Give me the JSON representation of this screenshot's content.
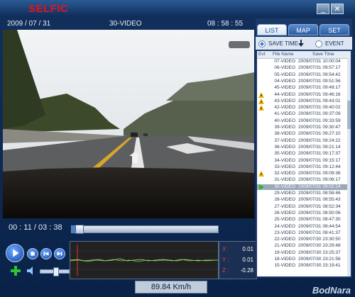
{
  "app": {
    "brand": "SELFIC"
  },
  "window_buttons": {
    "minimize": "_",
    "close": "✕"
  },
  "video_header": {
    "date": "2009 / 07 / 31",
    "title": "30-VIDEO",
    "time": "08 : 58 : 55"
  },
  "playback": {
    "time": "00 : 11 / 03 : 38",
    "progress": 0.05
  },
  "gsensor": {
    "x_label": "X :",
    "x_value": "0.01",
    "y_label": "Y :",
    "y_value": "0.01",
    "z_label": "Z :",
    "z_value": "-0.28"
  },
  "speed": "89.84 Km/h",
  "tabs": [
    "LIST",
    "MAP",
    "SET"
  ],
  "filter": {
    "save_time": "SAVE TIME",
    "event": "EVENT"
  },
  "list": {
    "headers": {
      "event": "Evt",
      "file_name": "File Name",
      "save_time": "Save Time"
    },
    "rows": [
      {
        "event": "",
        "name": "07-VIDEO",
        "time": "2009/07/31 10:00:04"
      },
      {
        "event": "",
        "name": "06-VIDEO",
        "time": "2009/07/31 09:57:17"
      },
      {
        "event": "",
        "name": "05-VIDEO",
        "time": "2009/07/31 09:54:42"
      },
      {
        "event": "",
        "name": "04-VIDEO",
        "time": "2009/07/31 09:51:56"
      },
      {
        "event": "",
        "name": "45-VIDEO",
        "time": "2009/07/31 09:49:17"
      },
      {
        "event": "warning",
        "name": "44-VIDEO",
        "time": "2009/07/31 09:46:16"
      },
      {
        "event": "warning",
        "name": "43-VIDEO",
        "time": "2009/07/31 09:43:01"
      },
      {
        "event": "warning",
        "name": "42-VIDEO",
        "time": "2009/07/31 09:40:02"
      },
      {
        "event": "",
        "name": "41-VIDEO",
        "time": "2009/07/31 09:37:09"
      },
      {
        "event": "",
        "name": "40-VIDEO",
        "time": "2009/07/31 09:33:59"
      },
      {
        "event": "",
        "name": "39-VIDEO",
        "time": "2009/07/31 09:30:47"
      },
      {
        "event": "",
        "name": "38-VIDEO",
        "time": "2009/07/31 09:27:10"
      },
      {
        "event": "",
        "name": "37-VIDEO",
        "time": "2009/07/31 09:24:22"
      },
      {
        "event": "",
        "name": "36-VIDEO",
        "time": "2009/07/31 09:21:14"
      },
      {
        "event": "",
        "name": "35-VIDEO",
        "time": "2009/07/31 09:17:37"
      },
      {
        "event": "",
        "name": "34-VIDEO",
        "time": "2009/07/31 09:15:17"
      },
      {
        "event": "",
        "name": "33-VIDEO",
        "time": "2009/07/31 09:12:44"
      },
      {
        "event": "warning",
        "name": "32-VIDEO",
        "time": "2009/07/31 09:09:36"
      },
      {
        "event": "",
        "name": "31-VIDEO",
        "time": "2009/07/31 09:06:17"
      },
      {
        "event": "play",
        "name": "30-VIDEO",
        "time": "2009/07/31 09:02:24",
        "selected": true
      },
      {
        "event": "",
        "name": "29-VIDEO",
        "time": "2009/07/31 08:58:46"
      },
      {
        "event": "",
        "name": "28-VIDEO",
        "time": "2009/07/31 08:55:43"
      },
      {
        "event": "",
        "name": "27-VIDEO",
        "time": "2009/07/31 08:52:34"
      },
      {
        "event": "",
        "name": "26-VIDEO",
        "time": "2009/07/31 08:50:06"
      },
      {
        "event": "",
        "name": "25-VIDEO",
        "time": "2009/07/31 08:47:30"
      },
      {
        "event": "",
        "name": "24-VIDEO",
        "time": "2009/07/31 08:44:54"
      },
      {
        "event": "",
        "name": "23-VIDEO",
        "time": "2009/07/31 08:41:37"
      },
      {
        "event": "",
        "name": "22-VIDEO",
        "time": "2009/07/30 23:30:50"
      },
      {
        "event": "",
        "name": "21-VIDEO",
        "time": "2009/07/30 23:29:48"
      },
      {
        "event": "",
        "name": "19-VIDEO",
        "time": "2009/07/30 23:25:37"
      },
      {
        "event": "",
        "name": "18-VIDEO",
        "time": "2009/07/30 23:21:56"
      },
      {
        "event": "",
        "name": "15-VIDEO",
        "time": "2009/07/30 23:19:41"
      }
    ]
  },
  "colors": {
    "brand": "#e8121c",
    "warning": "#f0b400",
    "play": "#28b428",
    "accent": "#3a7fe0"
  },
  "watermark": "BodNara"
}
